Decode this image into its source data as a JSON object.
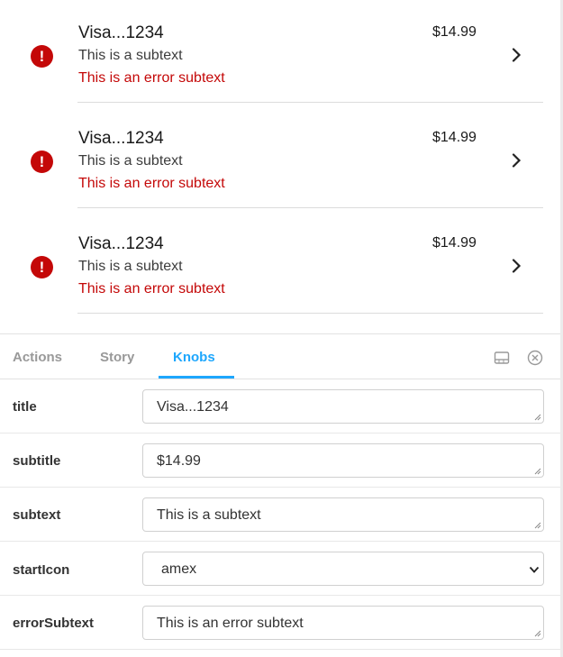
{
  "preview": {
    "rows": [
      {
        "title": "Visa...1234",
        "subtext": "This is a subtext",
        "error_subtext": "This is an error subtext",
        "amount": "$14.99",
        "icon": "error-exclamation-icon"
      },
      {
        "title": "Visa...1234",
        "subtext": "This is a subtext",
        "error_subtext": "This is an error subtext",
        "amount": "$14.99",
        "icon": "error-exclamation-icon"
      },
      {
        "title": "Visa...1234",
        "subtext": "This is a subtext",
        "error_subtext": "This is an error subtext",
        "amount": "$14.99",
        "icon": "error-exclamation-icon"
      }
    ],
    "error_icon_glyph": "!"
  },
  "addons": {
    "tabs": [
      {
        "label": "Actions"
      },
      {
        "label": "Story"
      },
      {
        "label": "Knobs"
      }
    ],
    "active_tab": "Knobs",
    "accent_color": "#1ea7fd",
    "tool_icons": [
      "panel-layout-icon",
      "close-circle-icon"
    ]
  },
  "knobs": [
    {
      "label": "title",
      "value": "Visa...1234",
      "type": "text"
    },
    {
      "label": "subtitle",
      "value": "$14.99",
      "type": "text"
    },
    {
      "label": "subtext",
      "value": "This is a subtext",
      "type": "text"
    },
    {
      "label": "startIcon",
      "value": "amex",
      "type": "select"
    },
    {
      "label": "errorSubtext",
      "value": "This is an error subtext",
      "type": "text"
    }
  ],
  "colors": {
    "error": "#c40808"
  }
}
